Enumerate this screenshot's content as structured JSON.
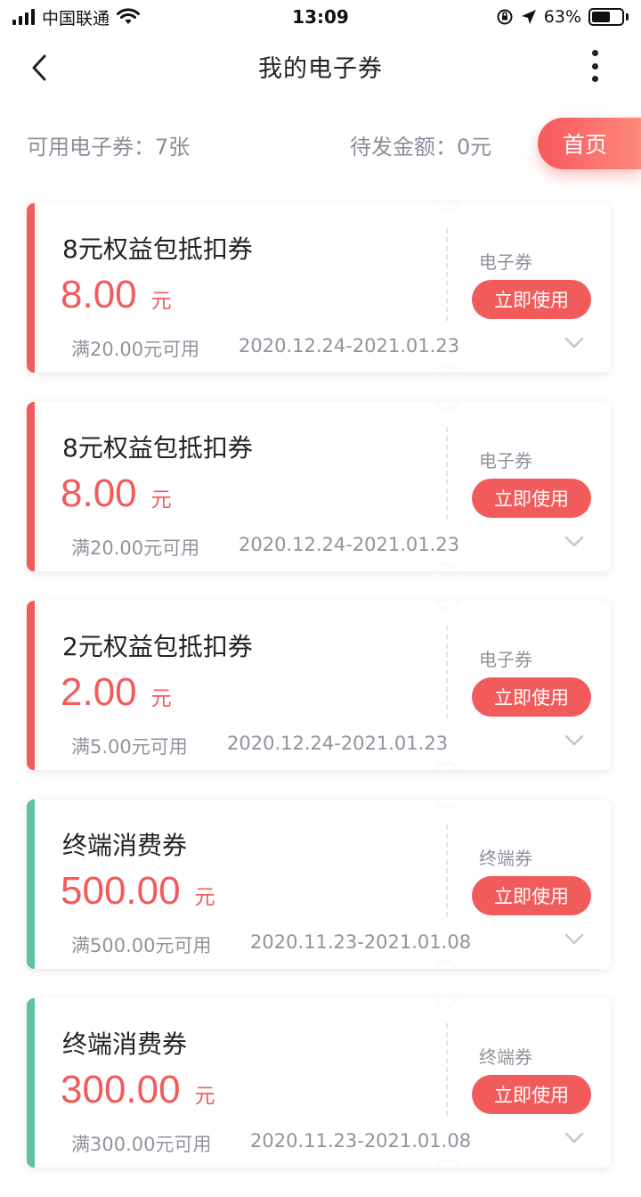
{
  "status_bar": {
    "carrier": "中国联通",
    "time": "13:09",
    "battery": "63%",
    "battery_level": 0.63
  },
  "nav": {
    "title": "我的电子券"
  },
  "summary": {
    "available": "可用电子券：7张",
    "pending": "待发金额：0元",
    "home_label": "首页"
  },
  "colors": {
    "accent": "#f25b5b",
    "teal": "#62c0a6"
  },
  "coupons": [
    {
      "name": "8元权益包抵扣券",
      "amount": "8.00",
      "unit": "元",
      "condition": "满20.00元可用",
      "date": "2020.12.24-2021.01.23",
      "type": "电子券",
      "action": "立即使用",
      "bar_color": "#f25b5b"
    },
    {
      "name": "8元权益包抵扣券",
      "amount": "8.00",
      "unit": "元",
      "condition": "满20.00元可用",
      "date": "2020.12.24-2021.01.23",
      "type": "电子券",
      "action": "立即使用",
      "bar_color": "#f25b5b"
    },
    {
      "name": "2元权益包抵扣券",
      "amount": "2.00",
      "unit": "元",
      "condition": "满5.00元可用",
      "date": "2020.12.24-2021.01.23",
      "type": "电子券",
      "action": "立即使用",
      "bar_color": "#f25b5b"
    },
    {
      "name": "终端消费券",
      "amount": "500.00",
      "unit": "元",
      "condition": "满500.00元可用",
      "date": "2020.11.23-2021.01.08",
      "type": "终端券",
      "action": "立即使用",
      "bar_color": "#62c0a6"
    },
    {
      "name": "终端消费券",
      "amount": "300.00",
      "unit": "元",
      "condition": "满300.00元可用",
      "date": "2020.11.23-2021.01.08",
      "type": "终端券",
      "action": "立即使用",
      "bar_color": "#62c0a6"
    }
  ]
}
